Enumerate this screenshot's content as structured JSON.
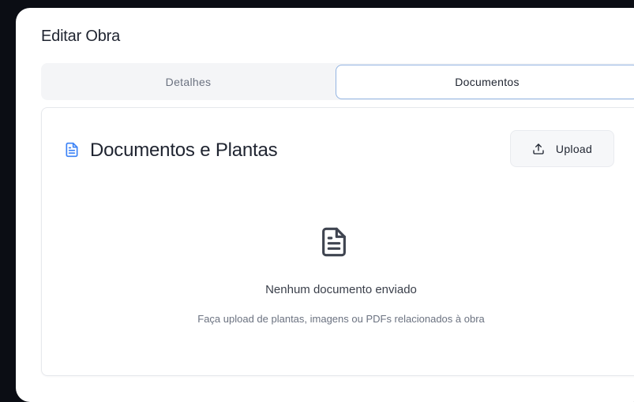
{
  "dialog": {
    "title": "Editar Obra",
    "close_symbol": "×"
  },
  "tabs": [
    {
      "label": "Detalhes",
      "active": false
    },
    {
      "label": "Documentos",
      "active": true
    }
  ],
  "documents": {
    "title": "Documentos e Plantas",
    "title_icon": "file-text-icon",
    "upload_label": "Upload",
    "upload_icon": "upload-icon",
    "empty_state": {
      "icon": "file-text-icon",
      "title": "Nenhum documento enviado",
      "subtitle": "Faça upload de plantas, imagens ou PDFs relacionados à obra"
    }
  },
  "colors": {
    "accent": "#3b82f6",
    "active_tab_border": "#93b4e2",
    "backdrop": "#0b0d14"
  }
}
